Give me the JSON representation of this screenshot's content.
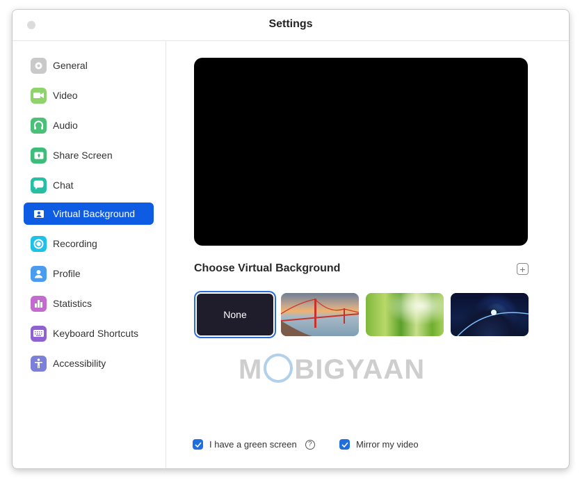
{
  "window": {
    "title": "Settings"
  },
  "sidebar": {
    "items": [
      {
        "label": "General",
        "icon": "gear-icon",
        "color": "#c9c9c9",
        "active": false
      },
      {
        "label": "Video",
        "icon": "video-camera-icon",
        "color": "#8ed36c",
        "active": false
      },
      {
        "label": "Audio",
        "icon": "headphones-icon",
        "color": "#4cbf79",
        "active": false
      },
      {
        "label": "Share Screen",
        "icon": "share-screen-icon",
        "color": "#3dbd7a",
        "active": false
      },
      {
        "label": "Chat",
        "icon": "chat-bubble-icon",
        "color": "#26bfa3",
        "active": false
      },
      {
        "label": "Virtual Background",
        "icon": "person-card-icon",
        "color": "#0e5ce3",
        "active": true
      },
      {
        "label": "Recording",
        "icon": "record-icon",
        "color": "#1ec2e6",
        "active": false
      },
      {
        "label": "Profile",
        "icon": "person-icon",
        "color": "#4a9cf0",
        "active": false
      },
      {
        "label": "Statistics",
        "icon": "bar-chart-icon",
        "color": "#c46bd0",
        "active": false
      },
      {
        "label": "Keyboard Shortcuts",
        "icon": "keyboard-icon",
        "color": "#8f62d1",
        "active": false
      },
      {
        "label": "Accessibility",
        "icon": "accessibility-icon",
        "color": "#7c80d8",
        "active": false
      }
    ]
  },
  "main": {
    "section_title": "Choose Virtual Background",
    "add_button": "+",
    "backgrounds": [
      {
        "label": "None",
        "selected": true
      },
      {
        "label": "Golden Gate Bridge",
        "selected": false
      },
      {
        "label": "Grass",
        "selected": false
      },
      {
        "label": "Earth from space",
        "selected": false
      }
    ],
    "watermark": {
      "left": "M",
      "right": "BIGYAAN"
    },
    "options": [
      {
        "label": "I have a green screen",
        "checked": true,
        "help": "?"
      },
      {
        "label": "Mirror my video",
        "checked": true
      }
    ]
  },
  "colors": {
    "accent": "#0e5ce3",
    "checkbox": "#1f6fe0"
  }
}
